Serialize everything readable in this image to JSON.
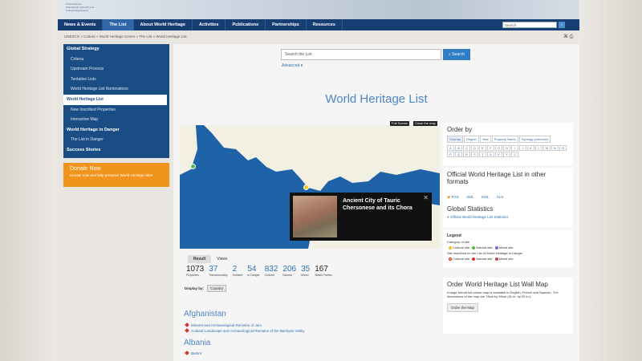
{
  "banner": {
    "org_lines": [
      "United Nations",
      "Educational, Scientific and",
      "Cultural Organization"
    ]
  },
  "nav": {
    "items": [
      "News & Events",
      "The List",
      "About World Heritage",
      "Activities",
      "Publications",
      "Partnerships",
      "Resources"
    ],
    "search_placeholder": "Search"
  },
  "breadcrumb": "UNESCO » Culture » World Heritage Centre » The List » World Heritage List",
  "sidebar": {
    "items": [
      {
        "label": "Global Strategy",
        "type": "head"
      },
      {
        "label": "Criteria",
        "type": "sub"
      },
      {
        "label": "Upstream Process",
        "type": "sub"
      },
      {
        "label": "Tentative Lists",
        "type": "sub"
      },
      {
        "label": "World Heritage List Nominations",
        "type": "sub"
      },
      {
        "label": "World Heritage List",
        "type": "active"
      },
      {
        "label": "New Inscribed Properties",
        "type": "sub"
      },
      {
        "label": "Interactive Map",
        "type": "sub"
      },
      {
        "label": "World Heritage in Danger",
        "type": "head"
      },
      {
        "label": "The List in Danger",
        "type": "sub"
      },
      {
        "label": "Success Stories",
        "type": "head"
      }
    ]
  },
  "donate": {
    "title": "Donate Now",
    "desc": "Donate now and help preserve World Heritage sites"
  },
  "search": {
    "placeholder": "Search the List",
    "button": "Search",
    "advanced": "Advanced ▾"
  },
  "main": {
    "title": "World Heritage List"
  },
  "map": {
    "fullscreen": "Full Screen",
    "close": "Close the map",
    "popup_title": "Ancient City of Tauric Chersonese and its Chora",
    "popup_close": "✕",
    "colors": {
      "sea": "#1e63a8",
      "land": "#f2efe3",
      "cultural_pin": "#f3c31a",
      "natural_pin": "#5bb94a"
    }
  },
  "results": {
    "tabs": [
      "Result",
      "Views"
    ],
    "stats": [
      {
        "value": "1073",
        "label": "Properties"
      },
      {
        "value": "37",
        "label": "Transboundary"
      },
      {
        "value": "2",
        "label": "Delisted"
      },
      {
        "value": "54",
        "label": "In Danger"
      },
      {
        "value": "832",
        "label": "Cultural"
      },
      {
        "value": "206",
        "label": "Natural"
      },
      {
        "value": "35",
        "label": "Mixed"
      },
      {
        "value": "167",
        "label": "States Parties"
      }
    ],
    "display_by_label": "Display by:",
    "display_by_value": "Country"
  },
  "countries": [
    {
      "name": "Afghanistan",
      "sites": [
        "Minaret and Archaeological Remains of Jam",
        "Cultural Landscape and Archaeological Remains of the Bamiyan Valley"
      ]
    },
    {
      "name": "Albania",
      "sites": [
        "Butrint"
      ]
    }
  ],
  "order_by": {
    "title": "Order by",
    "buttons": [
      "Country",
      "Region",
      "Year",
      "Property Name",
      "Synergy protection"
    ],
    "letters": [
      "A",
      "B",
      "C",
      "D",
      "E",
      "F",
      "G",
      "H",
      "I",
      "J",
      "K",
      "L",
      "M",
      "N",
      "O",
      "P",
      "Q",
      "R",
      "S",
      "T",
      "U",
      "V",
      "Y",
      "Z"
    ]
  },
  "official": {
    "title": "Official World Heritage List in other formats",
    "formats": [
      "RSS",
      "XML",
      "KML",
      "XLS"
    ],
    "stats_title": "Global Statistics",
    "stats_link": "Official World Heritage List Statistics"
  },
  "legend": {
    "title": "Legend",
    "category_label": "Category of site",
    "danger_label": "Site inscribed on the List of World Heritage in Danger",
    "items": [
      "Cultural site",
      "Natural site",
      "Mixed site"
    ],
    "colors": {
      "cultural": "#f3c31a",
      "natural": "#5bb94a",
      "mixed": "#7b6cc0",
      "danger_cultural": "#f3c31a",
      "danger_natural": "#d2352d"
    }
  },
  "wallmap": {
    "title": "Order World Heritage List Wall Map",
    "desc": "A large format full-colour map is available in English, French and Spanish. The dimensions of the map are 78cm by 50cm (31 in. by 20 in.).",
    "button": "Order the Map"
  }
}
